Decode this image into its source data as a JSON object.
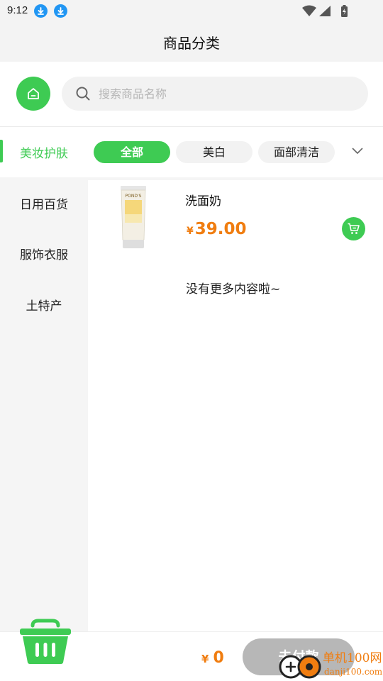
{
  "status_bar": {
    "time": "9:12"
  },
  "header": {
    "title": "商品分类"
  },
  "search": {
    "placeholder": "搜索商品名称",
    "value": ""
  },
  "category": {
    "active_label": "美妆护肤",
    "chips": [
      {
        "label": "全部",
        "active": true
      },
      {
        "label": "美白",
        "active": false
      },
      {
        "label": "面部清洁",
        "active": false
      }
    ]
  },
  "sidebar": {
    "items": [
      {
        "label": "日用百货"
      },
      {
        "label": "服饰衣服"
      },
      {
        "label": "土特产"
      }
    ]
  },
  "products": [
    {
      "name": "洗面奶",
      "currency": "¥",
      "price": "39.00",
      "image_text": "POND'S"
    }
  ],
  "list_footer": "没有更多内容啦~",
  "bottom_bar": {
    "currency": "¥",
    "total": "0",
    "pay_label": "去付款"
  },
  "watermark": {
    "text": "单机100网",
    "subtext": "danji100.com"
  },
  "colors": {
    "accent": "#3ecb53",
    "price": "#f07d10",
    "pay_disabled": "#b7b7b7",
    "sidebar_bg": "#f5f5f5"
  }
}
